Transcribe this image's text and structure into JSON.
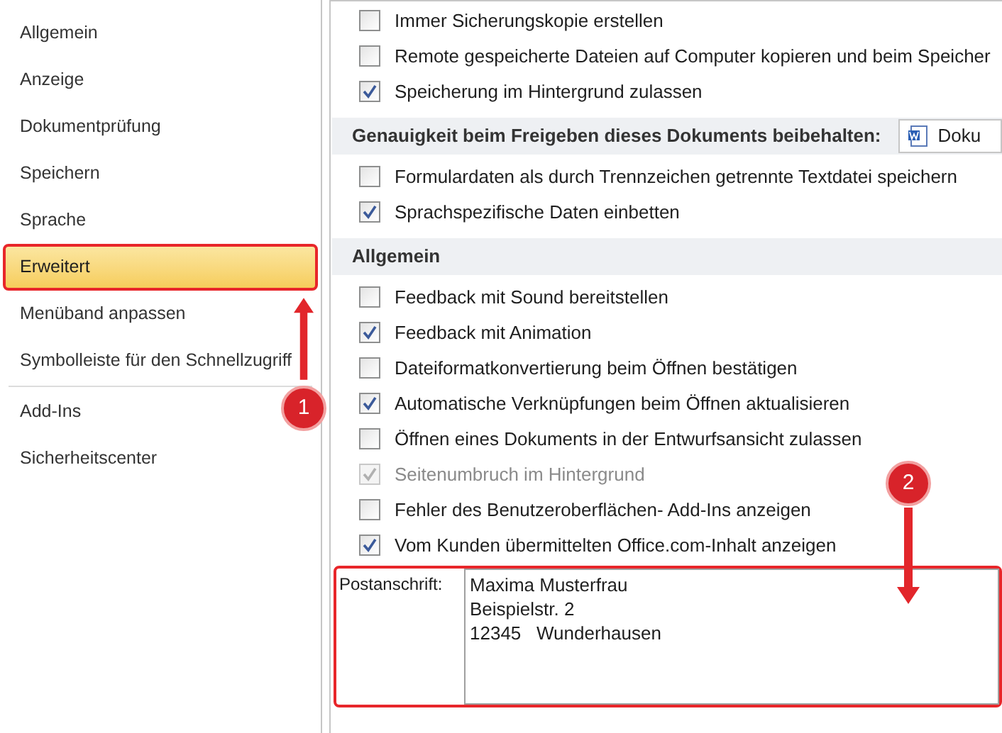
{
  "sidebar": {
    "items": [
      {
        "label": "Allgemein",
        "selected": false
      },
      {
        "label": "Anzeige",
        "selected": false
      },
      {
        "label": "Dokumentprüfung",
        "selected": false
      },
      {
        "label": "Speichern",
        "selected": false
      },
      {
        "label": "Sprache",
        "selected": false
      },
      {
        "label": "Erweitert",
        "selected": true
      },
      {
        "label": "Menüband anpassen",
        "selected": false
      },
      {
        "label": "Symbolleiste für den Schnellzugriff",
        "selected": false
      },
      {
        "label": "Add-Ins",
        "selected": false
      },
      {
        "label": "Sicherheitscenter",
        "selected": false
      }
    ]
  },
  "sections": [
    {
      "options": [
        {
          "label": "Immer Sicherungskopie erstellen",
          "checked": false,
          "disabled": false
        },
        {
          "label": "Remote gespeicherte Dateien auf Computer kopieren und beim Speicher",
          "checked": false,
          "disabled": false
        },
        {
          "label": "Speicherung im Hintergrund zulassen",
          "checked": true,
          "disabled": false
        }
      ]
    },
    {
      "title": "Genauigkeit beim Freigeben dieses Dokuments beibehalten:",
      "dropdown": "Doku",
      "options": [
        {
          "label": "Formulardaten als durch Trennzeichen getrennte Textdatei speichern",
          "checked": false,
          "disabled": false
        },
        {
          "label": "Sprachspezifische Daten einbetten",
          "checked": true,
          "disabled": false
        }
      ]
    },
    {
      "title": "Allgemein",
      "options": [
        {
          "label": "Feedback mit Sound bereitstellen",
          "checked": false,
          "disabled": false
        },
        {
          "label": "Feedback mit Animation",
          "checked": true,
          "disabled": false
        },
        {
          "label": "Dateiformatkonvertierung beim Öffnen bestätigen",
          "checked": false,
          "disabled": false
        },
        {
          "label": "Automatische Verknüpfungen beim Öffnen aktualisieren",
          "checked": true,
          "disabled": false
        },
        {
          "label": "Öffnen eines Dokuments in der Entwurfsansicht zulassen",
          "checked": false,
          "disabled": false
        },
        {
          "label": "Seitenumbruch im Hintergrund",
          "checked": true,
          "disabled": true
        },
        {
          "label": "Fehler des Benutzeroberflächen- Add-Ins anzeigen",
          "checked": false,
          "disabled": false
        },
        {
          "label": "Vom Kunden übermittelten Office.com-Inhalt anzeigen",
          "checked": true,
          "disabled": false
        }
      ]
    }
  ],
  "address": {
    "label": "Postanschrift:",
    "lines": [
      "Maxima Musterfrau",
      "Beispielstr. 2",
      "12345   Wunderhausen"
    ]
  },
  "annotations": [
    {
      "label": "1"
    },
    {
      "label": "2"
    }
  ]
}
